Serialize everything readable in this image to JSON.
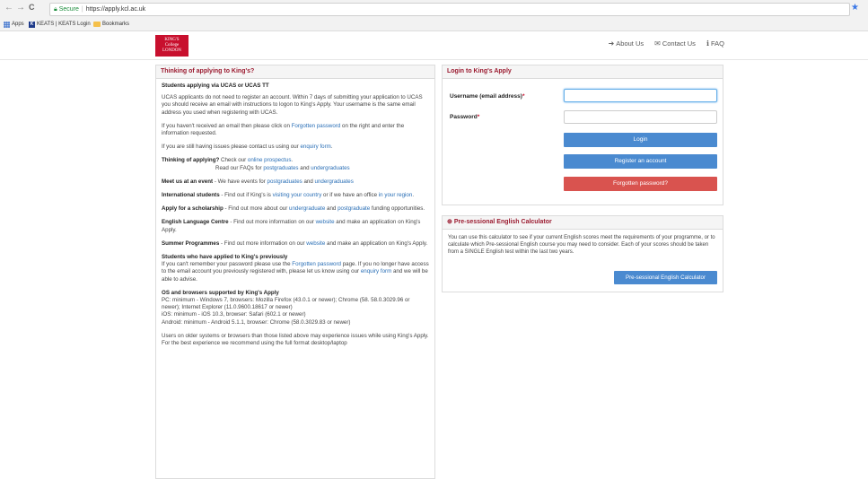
{
  "browser": {
    "back": "←",
    "forward": "→",
    "reload": "C",
    "secure_label": "Secure",
    "url": "https://apply.kcl.ac.uk",
    "bookmarks": [
      {
        "label": "Apps"
      },
      {
        "label": "KEATS | KEATS Login"
      },
      {
        "label": "Bookmarks"
      }
    ]
  },
  "header": {
    "logo_lines": [
      "KING'S",
      "College",
      "LONDON"
    ],
    "nav": [
      {
        "icon": "➜",
        "label": "About Us"
      },
      {
        "icon": "✉",
        "label": "Contact Us"
      },
      {
        "icon": "ℹ",
        "label": "FAQ"
      }
    ]
  },
  "left": {
    "title": "Thinking of applying to King's?",
    "ucas_heading": "Students applying via UCAS or UCAS TT",
    "ucas_text": "UCAS applicants do not need to register an account. Within 7 days of submitting your application to UCAS you should receive an email with instructions to logon to King's Apply. Your username is the same email address you used when registering with UCAS.",
    "no_email_pre": "If you haven't received an email then please click on ",
    "no_email_link": "Forgotten password",
    "no_email_post": " on the right and enter the information requested.",
    "issues_pre": "If you are still having issues please contact us using our ",
    "issues_link": "enquiry form",
    "issues_post": ".",
    "thinking_label": "Thinking of applying?",
    "thinking_pre": " Check our ",
    "thinking_link": "online prospectus",
    "thinking_post": ".",
    "faq_pre": "Read our FAQs for ",
    "faq_link1": "postgraduates",
    "faq_and": " and ",
    "faq_link2": "undergraduates",
    "meet_label": "Meet us at an event",
    "meet_pre": " - We have events for ",
    "meet_link1": "postgraduates",
    "meet_and": " and ",
    "meet_link2": "undergraduates",
    "intl_label": "International students",
    "intl_pre": " - Find out if King's is ",
    "intl_link1": "visiting your country",
    "intl_mid": " or if we have an office ",
    "intl_link2": "in your region",
    "intl_post": ".",
    "scholar_label": "Apply for a scholarship",
    "scholar_pre": " - Find out more about our ",
    "scholar_link1": "undergraduate",
    "scholar_and": " and ",
    "scholar_link2": "postgraduate",
    "scholar_post": " funding opportunities.",
    "elc_label": "English Language Centre",
    "elc_pre": " - Find out more information on our ",
    "elc_link": "website",
    "elc_post": " and make an application on King's Apply.",
    "summer_label": "Summer Programmes",
    "summer_pre": " - Find out more information on our ",
    "summer_link": "website",
    "summer_post": " and make an application on King's Apply.",
    "prev_heading": "Students who have applied to King's previously",
    "prev_pre": "If you can't remember your password please use the ",
    "prev_link": "Forgotten password",
    "prev_mid": " page. If you no longer have access to the email account you previously registered with, please let us know using our ",
    "prev_link2": "enquiry form",
    "prev_post": " and we will be able to advise.",
    "os_heading": "OS and browsers supported by King's Apply",
    "os_pc": "PC: minimum - Windows 7, browsers: Mozilla Firefox (43.0.1 or newer); Chrome (58. 58.0.3029.96 or newer); Internet Explorer (11.0.9600.18617 or newer)",
    "os_ios": "iOS: minimum - iOS 10.3, browser: Safari (602.1 or newer)",
    "os_android": "Android: minimum - Android 5.1.1, browser: Chrome (58.0.3029.83 or newer)",
    "older_text": "Users on older systems or browsers than those listed above may experience issues while using King's Apply. For the best experience we recommend using the full format desktop/laptop"
  },
  "login": {
    "title": "Login to King's Apply",
    "username_label": "Username (email address)",
    "password_label": "Password",
    "required_mark": "*",
    "login_button": "Login",
    "register_button": "Register an account",
    "forgot_button": "Forgotten password?"
  },
  "calc": {
    "title": "Pre-sessional English Calculator",
    "icon": "⊕",
    "text": "You can use this calculator to see if your current English scores meet the requirements of your programme, or to calculate which Pre-sessional English course you may need to consider. Each of your scores should be taken from a SINGLE English test within the last two years.",
    "button": "Pre-sessional English Calculator"
  }
}
